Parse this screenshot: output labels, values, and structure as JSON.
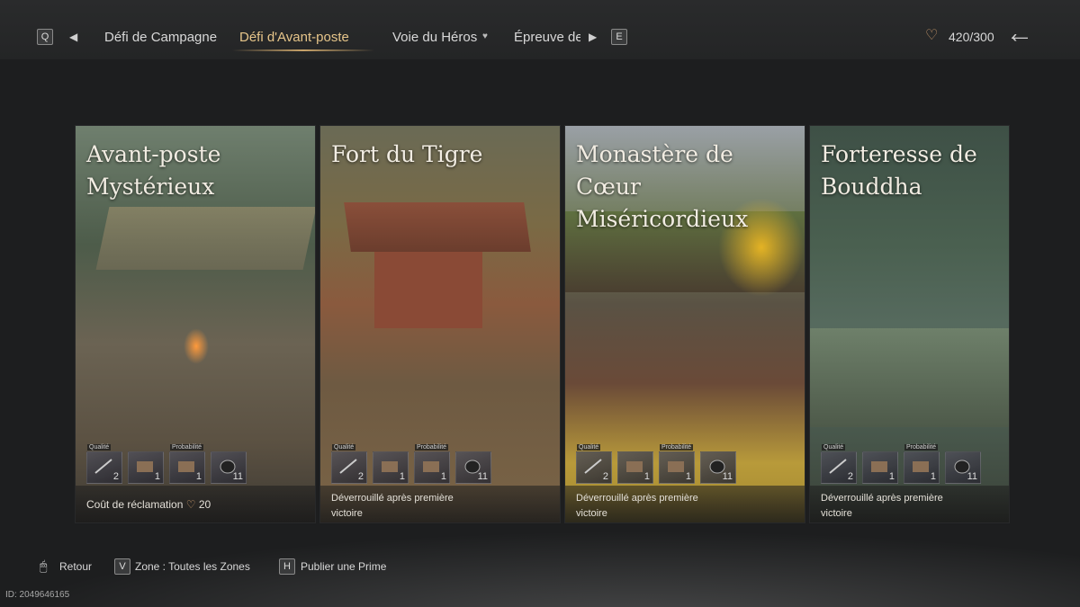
{
  "header": {
    "key_left": "Q",
    "key_right": "E",
    "tabs": [
      {
        "label": "Défi de Campagne"
      },
      {
        "label": "Défi d'Avant-poste"
      },
      {
        "label": "Voie du Héros"
      },
      {
        "label": "Épreuve de"
      }
    ],
    "currency": "420/300"
  },
  "cards": [
    {
      "title_line1": "Avant-poste",
      "title_line2": "Mystérieux",
      "rewards": [
        {
          "tag": "Qualité",
          "count": "2"
        },
        {
          "tag": "",
          "count": "1"
        },
        {
          "tag": "Probabilité",
          "count": "1"
        },
        {
          "tag": "",
          "count": "11"
        }
      ],
      "cost_label": "Coût de réclamation",
      "cost_value": "20"
    },
    {
      "title_line1": "Fort du Tigre",
      "title_line2": "",
      "rewards": [
        {
          "tag": "Qualité",
          "count": "2"
        },
        {
          "tag": "",
          "count": "1"
        },
        {
          "tag": "Probabilité",
          "count": "1"
        },
        {
          "tag": "",
          "count": "11"
        }
      ],
      "sub_line1": "Déverrouillé après première",
      "sub_line2": "victoire"
    },
    {
      "title_line1": "Monastère de Cœur",
      "title_line2": "Miséricordieux",
      "rewards": [
        {
          "tag": "Qualité",
          "count": "2"
        },
        {
          "tag": "",
          "count": "1"
        },
        {
          "tag": "Probabilité",
          "count": "1"
        },
        {
          "tag": "",
          "count": "11"
        }
      ],
      "sub_line1": "Déverrouillé après première",
      "sub_line2": "victoire"
    },
    {
      "title_line1": "Forteresse de",
      "title_line2": "Bouddha",
      "rewards": [
        {
          "tag": "Qualité",
          "count": "2"
        },
        {
          "tag": "",
          "count": "1"
        },
        {
          "tag": "Probabilité",
          "count": "1"
        },
        {
          "tag": "",
          "count": "11"
        }
      ],
      "sub_line1": "Déverrouillé après première",
      "sub_line2": "victoire"
    }
  ],
  "footer": {
    "back_label": "Retour",
    "zone_key": "V",
    "zone_label": "Zone : Toutes les Zones",
    "bounty_key": "H",
    "bounty_label": "Publier une Prime",
    "id_text": "ID: 2049646165"
  },
  "colors": {
    "accent": "#e6c58a",
    "heart": "#c7986a"
  }
}
